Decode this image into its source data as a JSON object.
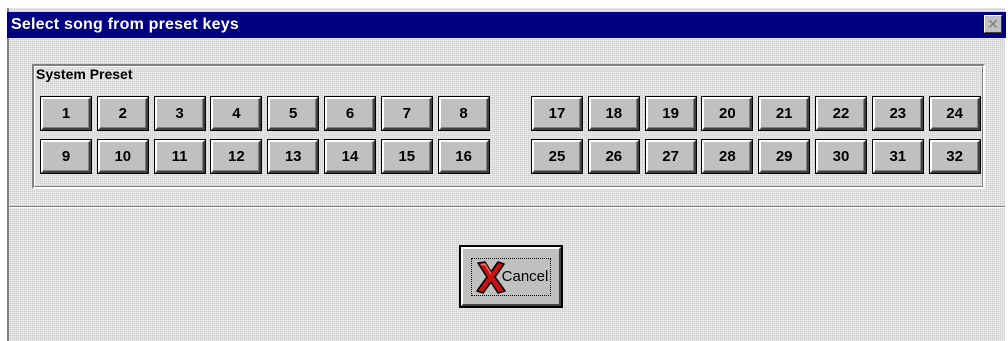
{
  "window": {
    "title": "Select song from preset keys",
    "close_glyph": "✕"
  },
  "group": {
    "label": "System Preset",
    "keys_left": [
      "1",
      "2",
      "3",
      "4",
      "5",
      "6",
      "7",
      "8",
      "9",
      "10",
      "11",
      "12",
      "13",
      "14",
      "15",
      "16"
    ],
    "keys_right": [
      "17",
      "18",
      "19",
      "20",
      "21",
      "22",
      "23",
      "24",
      "25",
      "26",
      "27",
      "28",
      "29",
      "30",
      "31",
      "32"
    ]
  },
  "buttons": {
    "cancel_label": "Cancel",
    "cancel_icon": "red-x-icon"
  },
  "colors": {
    "titlebar": "#000080",
    "face": "#c0c0c0",
    "cancel_icon": "#cc1010"
  }
}
